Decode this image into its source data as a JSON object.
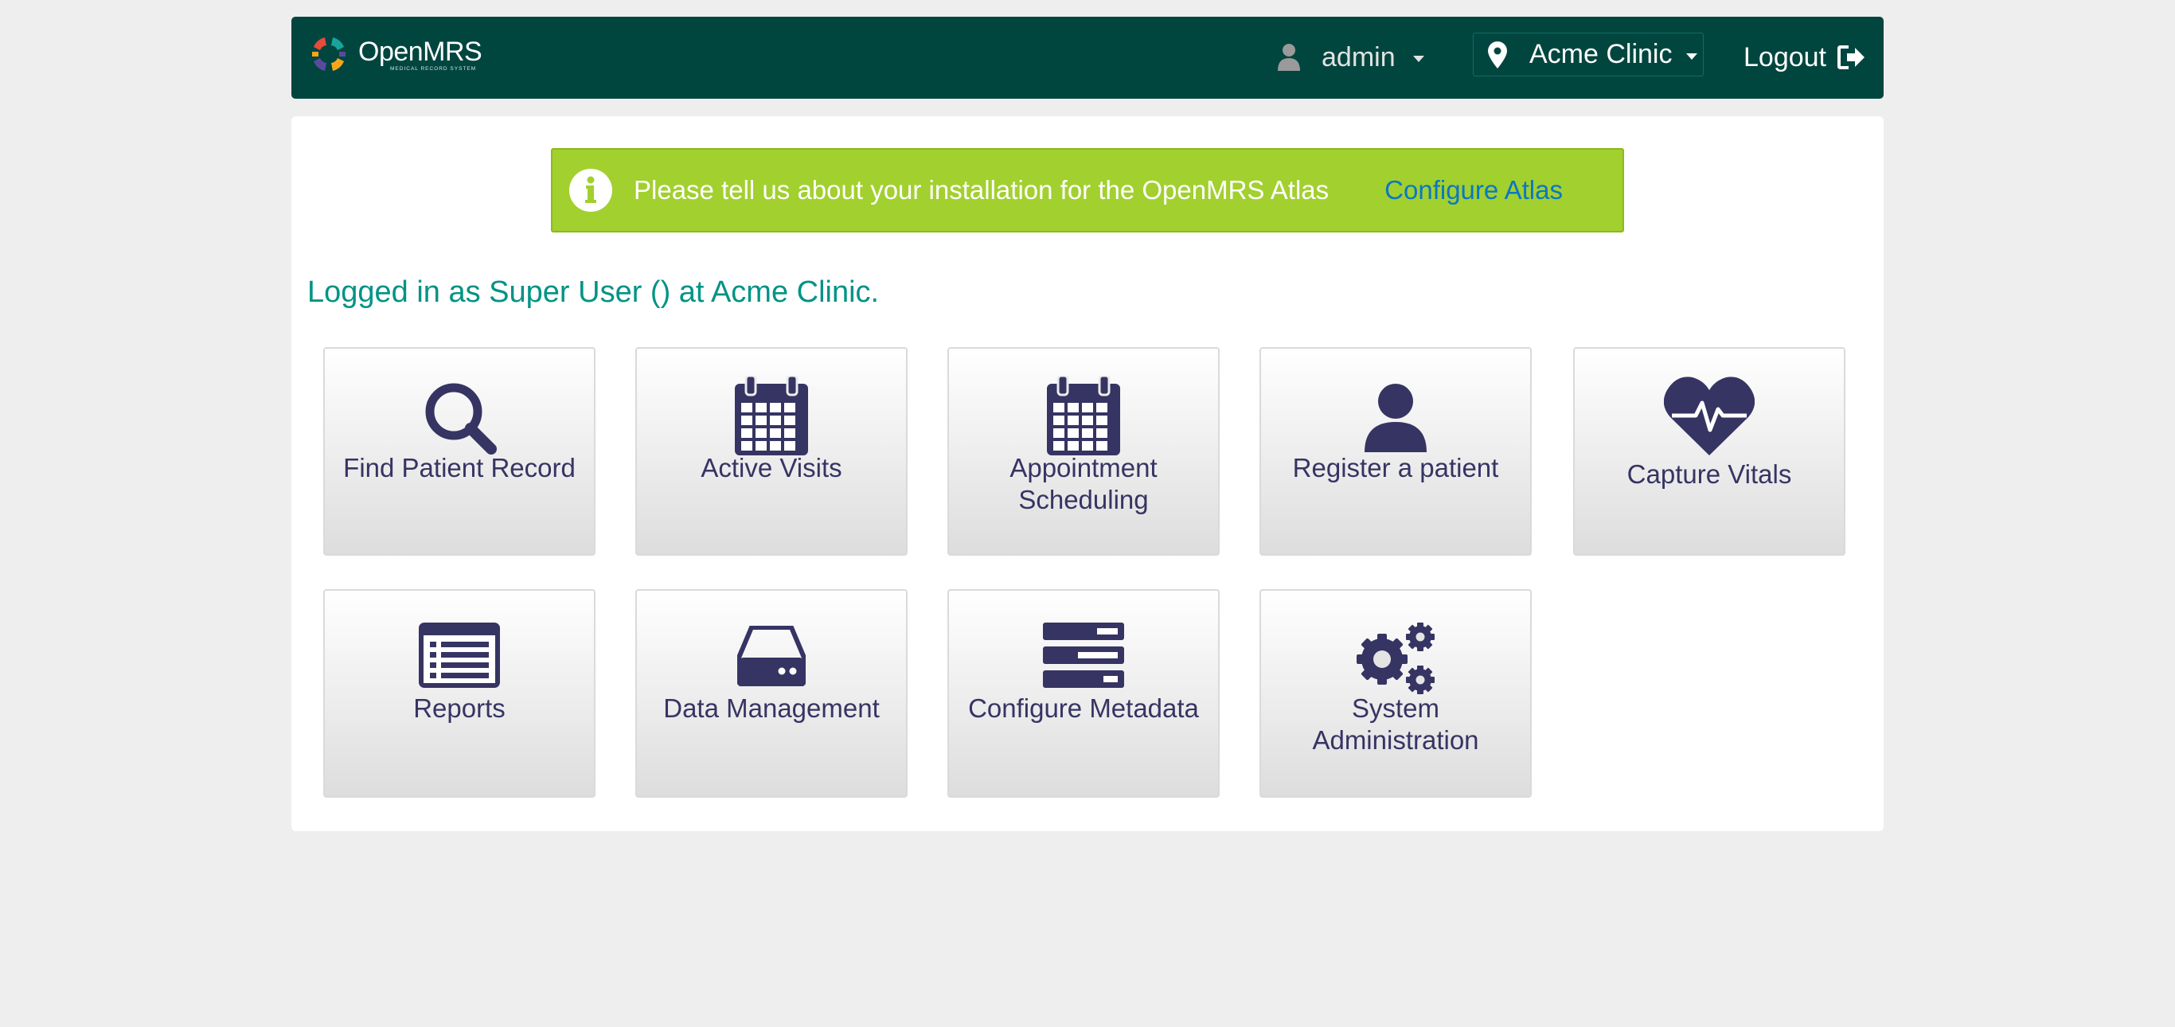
{
  "header": {
    "logo_name": "OpenMRS",
    "logo_sub": "MEDICAL RECORD SYSTEM",
    "user": "admin",
    "location": "Acme Clinic",
    "logout": "Logout"
  },
  "banner": {
    "text": "Please tell us about your installation for the OpenMRS Atlas",
    "link": "Configure Atlas"
  },
  "logged_in_text": "Logged in as Super User () at Acme Clinic.",
  "apps": {
    "find_patient": {
      "line1": "Find Patient Record",
      "icon": "search-icon"
    },
    "active_visits": {
      "line1": "Active Visits",
      "icon": "calendar-icon"
    },
    "appointment": {
      "line1": "Appointment",
      "line2": "Scheduling",
      "icon": "calendar-icon"
    },
    "register": {
      "line1": "Register a patient",
      "icon": "user-icon"
    },
    "vitals": {
      "line1": "Capture Vitals",
      "icon": "heartbeat-icon"
    },
    "reports": {
      "line1": "Reports",
      "icon": "list-alt-icon"
    },
    "data_mgmt": {
      "line1": "Data Management",
      "icon": "hdd-icon"
    },
    "metadata": {
      "line1": "Configure Metadata",
      "icon": "tasks-icon"
    },
    "sysadmin": {
      "line1": "System",
      "line2": "Administration",
      "icon": "gears-icon"
    }
  },
  "colors": {
    "header_bg": "#00463f",
    "banner_bg": "#a2d02f",
    "accent_teal": "#009384",
    "icon_navy": "#363463",
    "link_blue": "#0a78c2"
  }
}
